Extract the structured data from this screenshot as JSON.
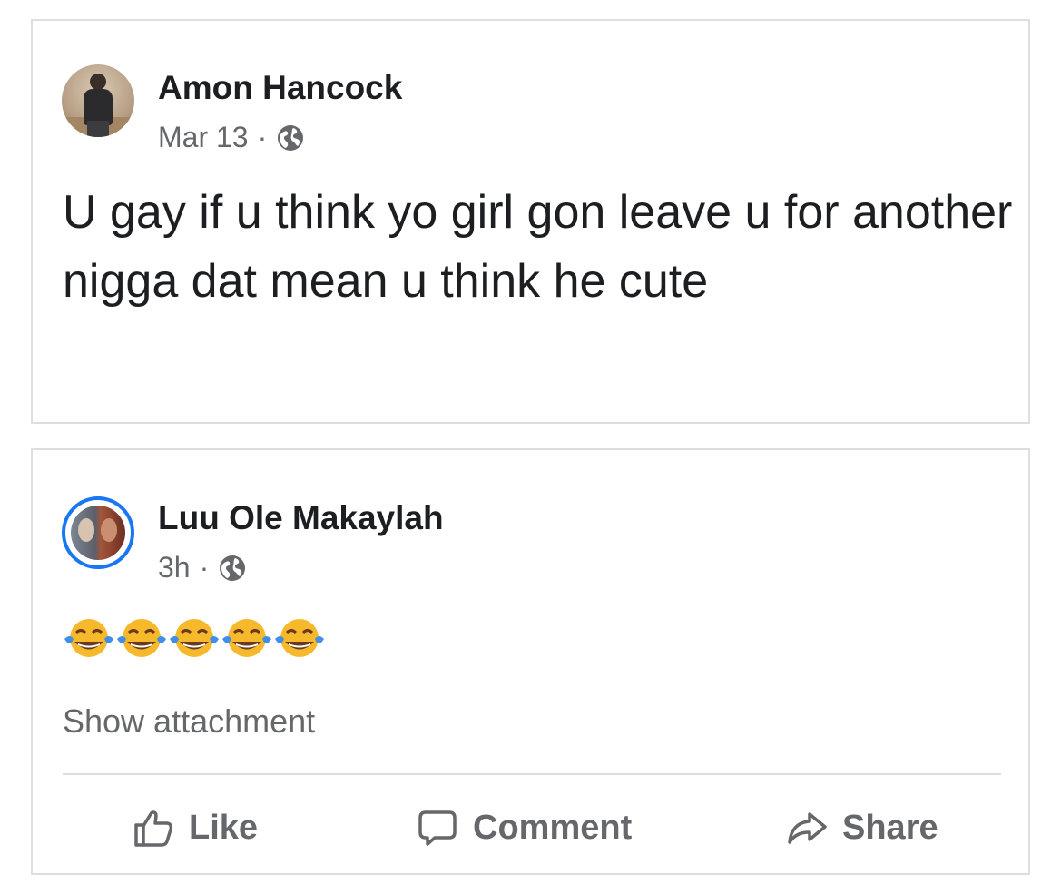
{
  "post": {
    "author": "Amon Hancock",
    "date": "Mar 13",
    "separator": "·",
    "privacy_icon": "globe-icon",
    "text": "U gay if u think yo girl gon leave u for another nigga dat mean u think he cute"
  },
  "comment": {
    "author": "Luu Ole Makaylah",
    "time": "3h",
    "separator": "·",
    "privacy_icon": "globe-icon",
    "emojis": [
      "😂",
      "😂",
      "😂",
      "😂",
      "😂"
    ],
    "show_attachment": "Show attachment"
  },
  "actions": {
    "like": "Like",
    "comment": "Comment",
    "share": "Share"
  },
  "colors": {
    "text_primary": "#1c1e21",
    "text_secondary": "#65676b",
    "border": "#dcdee2",
    "avatar_ring": "#1877f2"
  }
}
